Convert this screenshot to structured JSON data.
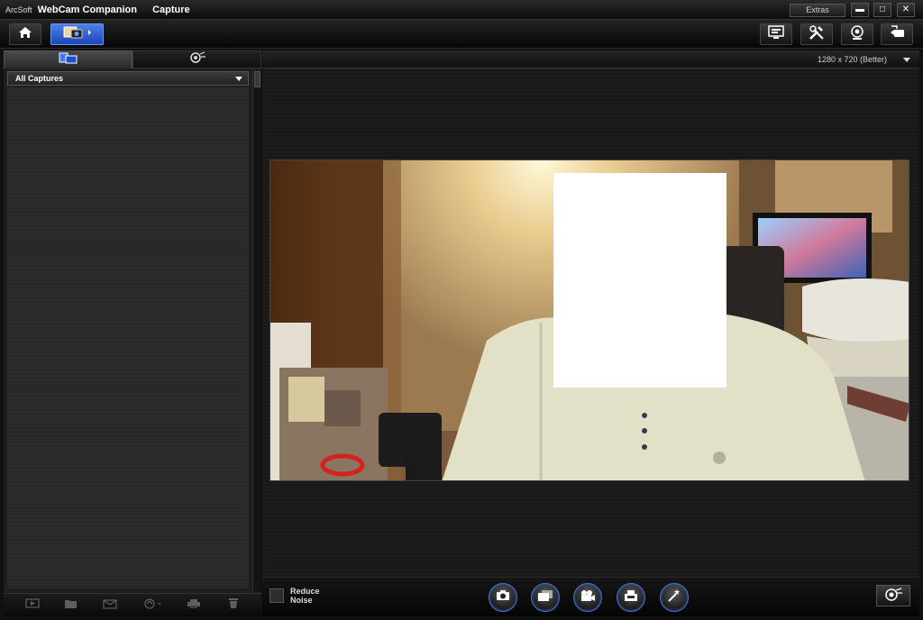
{
  "titlebar": {
    "brand_small": "ArcSoft",
    "app_name": "WebCam Companion",
    "mode": "Capture",
    "extras_label": "Extras",
    "minimize_glyph": "▬",
    "maximize_glyph": "□",
    "close_glyph": "✕"
  },
  "toolbar": {
    "home_icon": "home-icon",
    "capture_module_icon": "webcam-capture-icon",
    "right_icons": [
      "display-settings-icon",
      "tools-icon",
      "webcam-settings-icon",
      "share-icon"
    ]
  },
  "left_panel": {
    "tabs": [
      {
        "icon": "captures-icon",
        "active": true
      },
      {
        "icon": "effects-icon",
        "active": false
      }
    ],
    "filter_value": "All Captures",
    "bottom_icons": [
      "slideshow-icon",
      "open-folder-icon",
      "email-icon",
      "upload-icon",
      "print-icon",
      "delete-icon"
    ]
  },
  "preview": {
    "resolution_value": "1280 x 720 (Better)"
  },
  "capture_bar": {
    "reduce_noise_label_line1": "Reduce",
    "reduce_noise_label_line2": "Noise",
    "reduce_noise_checked": false,
    "buttons": [
      "camera-icon",
      "burst-icon",
      "video-icon",
      "time-lapse-icon",
      "magic-icon"
    ],
    "toggle_icon": "effects-toggle-icon"
  },
  "colors": {
    "accent": "#2e5fc8",
    "background": "#141414"
  }
}
